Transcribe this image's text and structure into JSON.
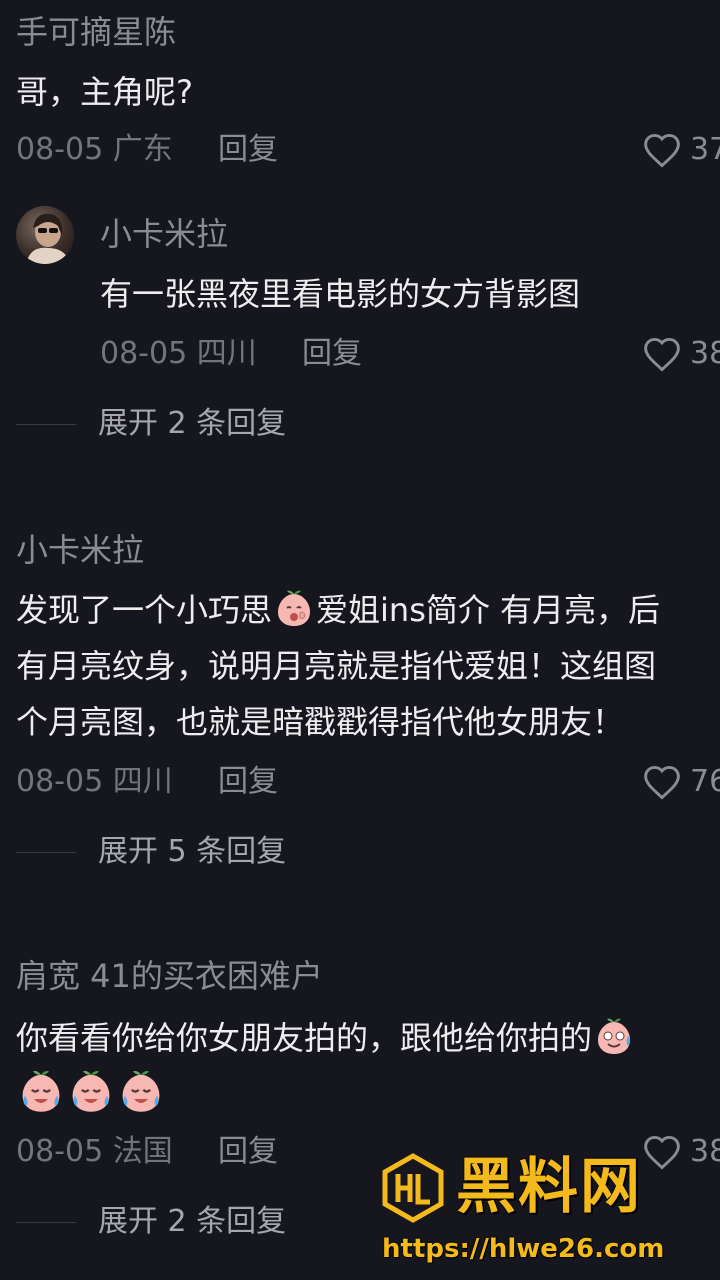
{
  "comments": [
    {
      "username": "手可摘星陈",
      "text": "哥，主角呢?",
      "date": "08-05",
      "location": "广东",
      "reply_label": "回复",
      "likes": "37"
    },
    {
      "username": "小卡米拉",
      "text": "有一张黑夜里看电影的女方背影图",
      "date": "08-05",
      "location": "四川",
      "reply_label": "回复",
      "likes": "38",
      "expand_label": "展开 2 条回复"
    },
    {
      "username": "小卡米拉",
      "text_line1_a": "发现了一个小巧思",
      "text_line1_b": "爱姐ins简介 有月亮，后",
      "text_line2": "有月亮纹身，说明月亮就是指代爱姐！这组图",
      "text_line3": "个月亮图，也就是暗戳戳得指代他女朋友！",
      "date": "08-05",
      "location": "四川",
      "reply_label": "回复",
      "likes": "76",
      "expand_label": "展开 5 条回复"
    },
    {
      "username": "肩宽 41的买衣困难户",
      "text_line1": "你看看你给你女朋友拍的，跟他给你拍的",
      "date": "08-05",
      "location": "法国",
      "reply_label": "回复",
      "likes": "38",
      "expand_label": "展开 2 条回复"
    }
  ],
  "watermark": {
    "title": "黑料网",
    "url": "https://hlwe26.com"
  },
  "colors": {
    "background": "#16161e",
    "accent": "#f4b91a"
  },
  "icons": {
    "like": "heart-outline-icon",
    "emoji_peach": "peach-face-emoji"
  }
}
